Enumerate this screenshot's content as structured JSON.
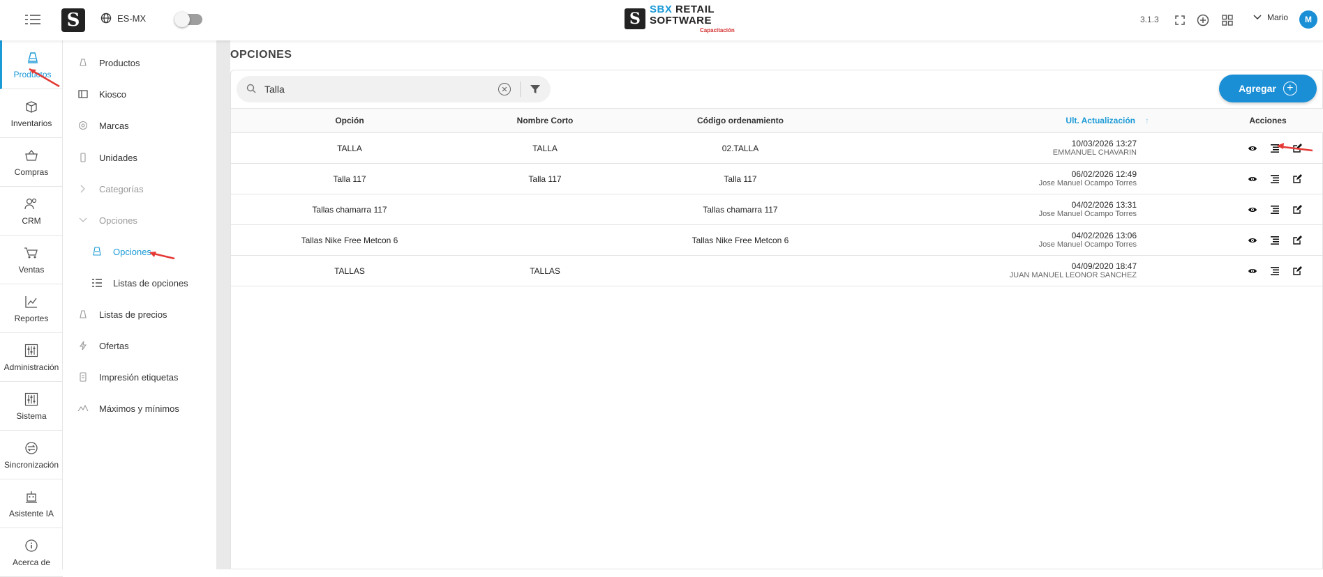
{
  "topbar": {
    "locale": "ES-MX",
    "brand": {
      "sbx": "SBX",
      "retail": "RETAIL",
      "software": "SOFTWARE",
      "sub": "Capacitación"
    },
    "version": "3.1.3",
    "user_name": "Mario",
    "avatar_initial": "M"
  },
  "leftnav": {
    "items": [
      {
        "label": "Productos",
        "icon": "products-icon"
      },
      {
        "label": "Inventarios",
        "icon": "box-icon"
      },
      {
        "label": "Compras",
        "icon": "basket-icon"
      },
      {
        "label": "CRM",
        "icon": "users-icon"
      },
      {
        "label": "Ventas",
        "icon": "cart-icon"
      },
      {
        "label": "Reportes",
        "icon": "chart-icon"
      },
      {
        "label": "Administración",
        "icon": "sliders-icon"
      },
      {
        "label": "Sistema",
        "icon": "sliders-icon"
      },
      {
        "label": "Sincronización",
        "icon": "sync-icon"
      },
      {
        "label": "Asistente IA",
        "icon": "robot-icon"
      },
      {
        "label": "Acerca de",
        "icon": "info-icon"
      }
    ]
  },
  "submenu": {
    "items": [
      {
        "label": "Productos"
      },
      {
        "label": "Kiosco"
      },
      {
        "label": "Marcas"
      },
      {
        "label": "Unidades"
      },
      {
        "label": "Categorías"
      },
      {
        "label": "Opciones"
      },
      {
        "label": "Opciones"
      },
      {
        "label": "Listas de opciones"
      },
      {
        "label": "Listas de precios"
      },
      {
        "label": "Ofertas"
      },
      {
        "label": "Impresión etiquetas"
      },
      {
        "label": "Máximos y mínimos"
      }
    ]
  },
  "main": {
    "title": "OPCIONES",
    "search_value": "Talla",
    "add_label": "Agregar",
    "columns": [
      "Opción",
      "Nombre Corto",
      "Código ordenamiento",
      "Ult. Actualización",
      "Acciones"
    ],
    "rows": [
      {
        "opcion": "TALLA",
        "nombre_corto": "TALLA",
        "codigo": "02.TALLA",
        "fecha": "10/03/2026 13:27",
        "usuario": "EMMANUEL CHAVARIN"
      },
      {
        "opcion": "Talla 117",
        "nombre_corto": "Talla 117",
        "codigo": "Talla 117",
        "fecha": "06/02/2026 12:49",
        "usuario": "Jose Manuel Ocampo Torres"
      },
      {
        "opcion": "Tallas chamarra 117",
        "nombre_corto": "",
        "codigo": "Tallas chamarra 117",
        "fecha": "04/02/2026 13:31",
        "usuario": "Jose Manuel Ocampo Torres"
      },
      {
        "opcion": "Tallas Nike Free Metcon 6",
        "nombre_corto": "",
        "codigo": "Tallas Nike Free Metcon 6",
        "fecha": "04/02/2026 13:06",
        "usuario": "Jose Manuel Ocampo Torres"
      },
      {
        "opcion": "TALLAS",
        "nombre_corto": "TALLAS",
        "codigo": "",
        "fecha": "04/09/2020 18:47",
        "usuario": "JUAN MANUEL LEONOR SANCHEZ"
      }
    ]
  },
  "colors": {
    "accent": "#1a8fd6",
    "annotation": "#e53935"
  }
}
